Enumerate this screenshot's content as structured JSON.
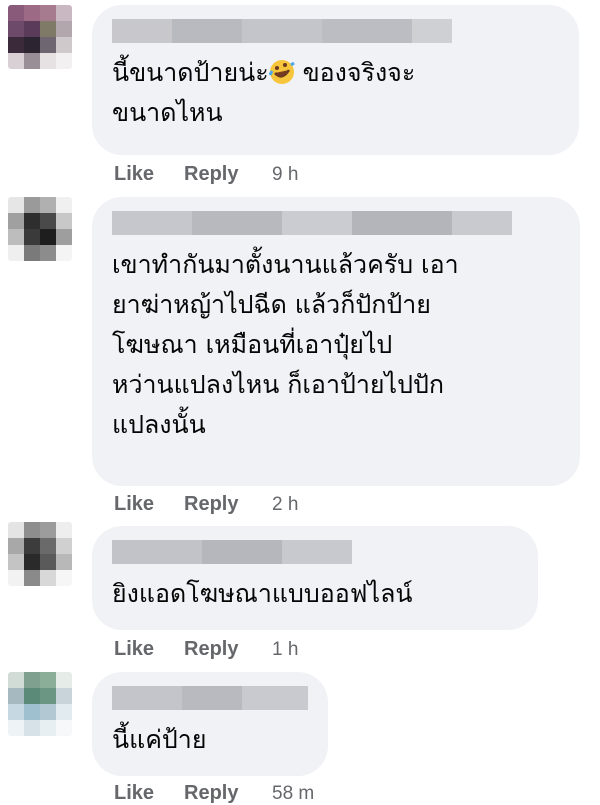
{
  "comments": [
    {
      "text": "นี้ขนาดป้ายน่ะ",
      "text_after_emoji": " ของจริงจะ\nขนาดไหน",
      "emoji": "rolling-on-floor-laughing-emoji",
      "like_label": "Like",
      "reply_label": "Reply",
      "time": "9 h"
    },
    {
      "text": "เขาทำกันมาตั้งนานแล้วครับ เอา\nยาฆ่าหญ้าไปฉีด แล้วก็ปักป้าย\nโฆษณา เหมือนที่เอาปุ๋ยไป\nหว่านแปลงไหน ก็เอาป้ายไปปัก\nแปลงนั้น",
      "like_label": "Like",
      "reply_label": "Reply",
      "time": "2 h"
    },
    {
      "text": "ยิงแอดโฆษณาแบบออฟไลน์",
      "like_label": "Like",
      "reply_label": "Reply",
      "time": "1 h"
    },
    {
      "text": "นี้แค่ป้าย",
      "like_label": "Like",
      "reply_label": "Reply",
      "time": "58 m"
    }
  ],
  "colors": {
    "bubble": "#f0f2f5",
    "text": "#050505",
    "meta": "#65676b"
  }
}
